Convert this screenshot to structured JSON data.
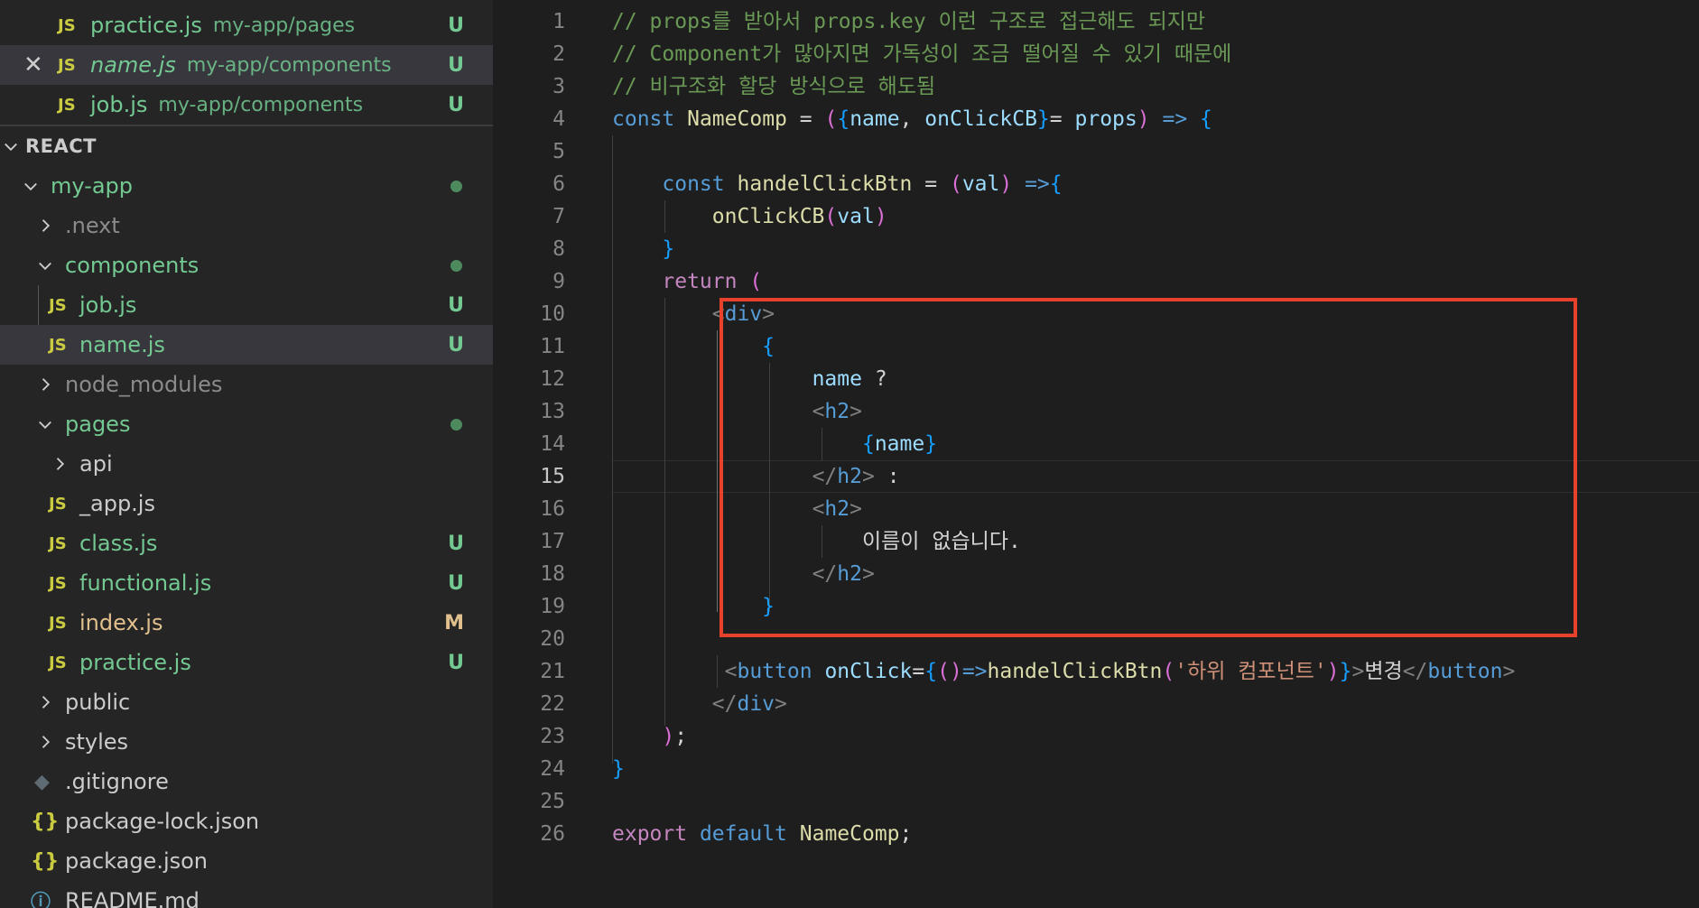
{
  "open_editors": [
    {
      "name": "practice.js",
      "path": "my-app/pages",
      "badge": "U"
    },
    {
      "name": "name.js",
      "path": "my-app/components",
      "badge": "U"
    },
    {
      "name": "job.js",
      "path": "my-app/components",
      "badge": "U"
    }
  ],
  "explorer": {
    "section_title": "REACT",
    "items": [
      {
        "label": "my-app",
        "type": "folder"
      },
      {
        "label": ".next",
        "type": "folder"
      },
      {
        "label": "components",
        "type": "folder"
      },
      {
        "label": "job.js",
        "type": "js",
        "badge": "U"
      },
      {
        "label": "name.js",
        "type": "js",
        "badge": "U"
      },
      {
        "label": "node_modules",
        "type": "folder"
      },
      {
        "label": "pages",
        "type": "folder"
      },
      {
        "label": "api",
        "type": "folder"
      },
      {
        "label": "_app.js",
        "type": "js"
      },
      {
        "label": "class.js",
        "type": "js",
        "badge": "U"
      },
      {
        "label": "functional.js",
        "type": "js",
        "badge": "U"
      },
      {
        "label": "index.js",
        "type": "js",
        "badge": "M"
      },
      {
        "label": "practice.js",
        "type": "js",
        "badge": "U"
      },
      {
        "label": "public",
        "type": "folder"
      },
      {
        "label": "styles",
        "type": "folder"
      },
      {
        "label": ".gitignore",
        "type": "git"
      },
      {
        "label": "package-lock.json",
        "type": "json"
      },
      {
        "label": "package.json",
        "type": "json"
      },
      {
        "label": "README.md",
        "type": "info"
      }
    ]
  },
  "icons": {
    "js": "JS",
    "json": "{}",
    "git": "◆",
    "info": "ⓘ",
    "close": "✕"
  },
  "editor": {
    "line_numbers": [
      "1",
      "2",
      "3",
      "4",
      "5",
      "6",
      "7",
      "8",
      "9",
      "10",
      "11",
      "12",
      "13",
      "14",
      "15",
      "16",
      "17",
      "18",
      "19",
      "20",
      "21",
      "22",
      "23",
      "24",
      "25",
      "26"
    ],
    "lines": [
      "// props를 받아서 props.key 이런 구조로 접근해도 되지만",
      "// Component가 많아지면 가독성이 조금 떨어질 수 있기 때문에",
      "// 비구조화 할당 방식으로 해도됨",
      "const NameComp = ({name, onClickCB}= props) => {",
      "",
      "    const handelClickBtn = (val) =>{",
      "        onClickCB(val)",
      "    }",
      "    return (",
      "        <div>",
      "            {",
      "                name ?",
      "                <h2>",
      "                    {name}",
      "                </h2> :",
      "                <h2>",
      "                    이름이 없습니다.",
      "                </h2>",
      "            }",
      "",
      "         <button onClick={()=>handelClickBtn('하위 컴포넌트')}>변경</button>",
      "        </div>",
      "    );",
      "}",
      "",
      "export default NameComp;"
    ]
  },
  "colors": {
    "accent_highlight": "#e8412c",
    "untracked": "#73c991",
    "modified": "#e2c08d"
  }
}
